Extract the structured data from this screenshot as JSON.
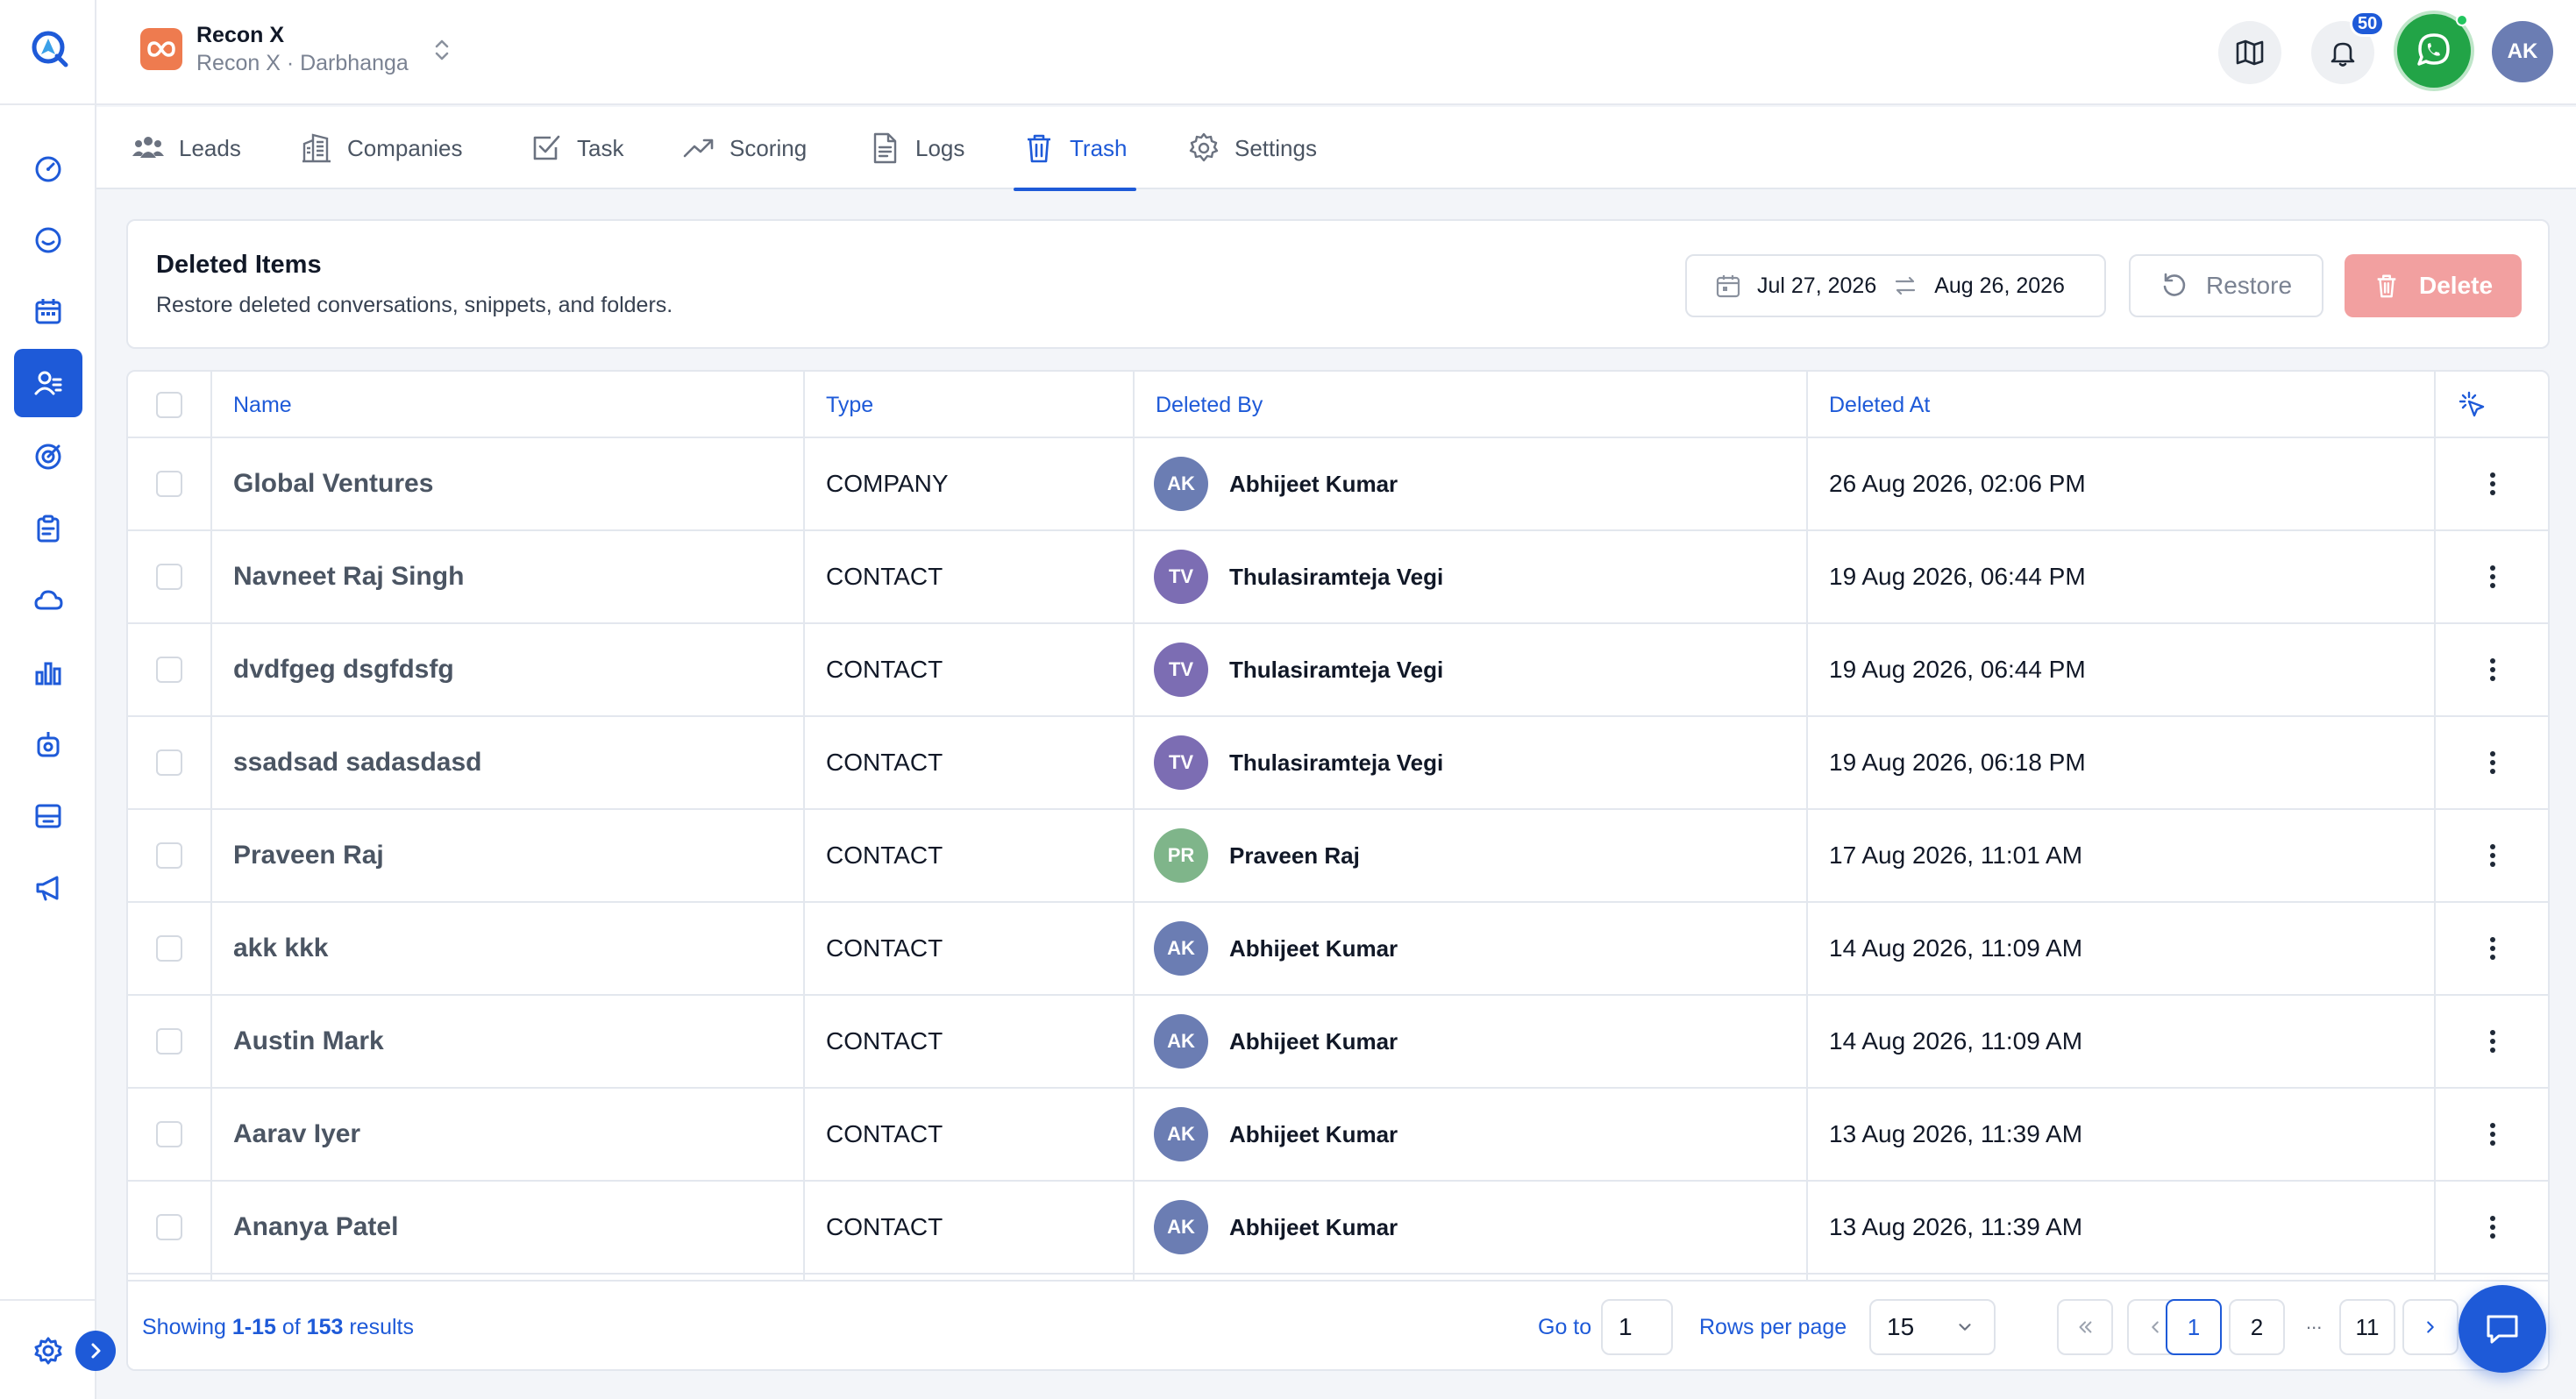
{
  "workspace": {
    "name": "Recon X",
    "subtitle": "Recon X · Darbhanga"
  },
  "header": {
    "notification_count": "50",
    "user_initials": "AK"
  },
  "tabs": [
    {
      "label": "Leads",
      "icon": "users-icon"
    },
    {
      "label": "Companies",
      "icon": "building-icon"
    },
    {
      "label": "Task",
      "icon": "checkbox-icon"
    },
    {
      "label": "Scoring",
      "icon": "trending-up-icon"
    },
    {
      "label": "Logs",
      "icon": "document-icon"
    },
    {
      "label": "Trash",
      "icon": "trash-icon"
    },
    {
      "label": "Settings",
      "icon": "gear-icon"
    }
  ],
  "active_tab": "Trash",
  "card": {
    "title": "Deleted Items",
    "description": "Restore deleted conversations, snippets, and folders.",
    "date_from": "Jul 27, 2026",
    "date_to": "Aug 26, 2026",
    "restore_label": "Restore",
    "delete_label": "Delete"
  },
  "table": {
    "columns": {
      "name": "Name",
      "type": "Type",
      "deleted_by": "Deleted By",
      "deleted_at": "Deleted At"
    },
    "rows": [
      {
        "name": "Global Ventures",
        "type": "COMPANY",
        "initials": "AK",
        "by": "Abhijeet Kumar",
        "at": "26 Aug 2026, 02:06 PM"
      },
      {
        "name": "Navneet Raj Singh",
        "type": "CONTACT",
        "initials": "TV",
        "by": "Thulasiramteja Vegi",
        "at": "19 Aug 2026, 06:44 PM"
      },
      {
        "name": "dvdfgeg dsgfdsfg",
        "type": "CONTACT",
        "initials": "TV",
        "by": "Thulasiramteja Vegi",
        "at": "19 Aug 2026, 06:44 PM"
      },
      {
        "name": "ssadsad sadasdasd",
        "type": "CONTACT",
        "initials": "TV",
        "by": "Thulasiramteja Vegi",
        "at": "19 Aug 2026, 06:18 PM"
      },
      {
        "name": "Praveen Raj",
        "type": "CONTACT",
        "initials": "PR",
        "by": "Praveen Raj",
        "at": "17 Aug 2026, 11:01 AM"
      },
      {
        "name": "akk kkk",
        "type": "CONTACT",
        "initials": "AK",
        "by": "Abhijeet Kumar",
        "at": "14 Aug 2026, 11:09 AM"
      },
      {
        "name": "Austin Mark",
        "type": "CONTACT",
        "initials": "AK",
        "by": "Abhijeet Kumar",
        "at": "14 Aug 2026, 11:09 AM"
      },
      {
        "name": "Aarav Iyer",
        "type": "CONTACT",
        "initials": "AK",
        "by": "Abhijeet Kumar",
        "at": "13 Aug 2026, 11:39 AM"
      },
      {
        "name": "Ananya Patel",
        "type": "CONTACT",
        "initials": "AK",
        "by": "Abhijeet Kumar",
        "at": "13 Aug 2026, 11:39 AM"
      }
    ]
  },
  "avatar_colors": {
    "AK": "#6b7db3",
    "TV": "#7c6db3",
    "PR": "#7fb58a"
  },
  "footer": {
    "showing_prefix": "Showing",
    "showing_range": "1-15",
    "showing_of": "of",
    "showing_total": "153",
    "showing_suffix": "results",
    "goto_label": "Go to",
    "goto_value": "1",
    "rows_per_page_label": "Rows per page",
    "rows_per_page_value": "15",
    "pages": [
      "1",
      "2"
    ],
    "ellipsis": "...",
    "last_page": "11"
  },
  "colors": {
    "accent": "#1e5ad8",
    "delete_disabled": "#f2a0a0",
    "whatsapp": "#22a447",
    "workspace_logo": "#ee7b4f"
  }
}
